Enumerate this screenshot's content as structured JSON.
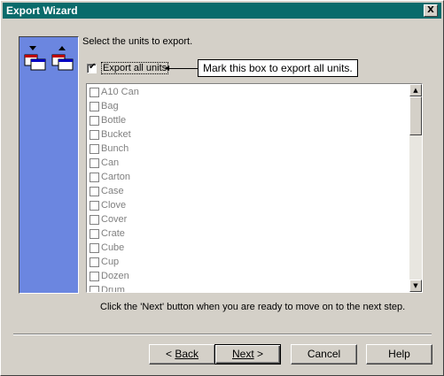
{
  "window": {
    "title": "Export Wizard",
    "close_glyph": "X"
  },
  "main": {
    "instruction": "Select the units to export.",
    "export_all": {
      "label": "Export all units",
      "checked": true
    },
    "callout": "Mark this box to export all units.",
    "units": [
      "A10 Can",
      "Bag",
      "Bottle",
      "Bucket",
      "Bunch",
      "Can",
      "Carton",
      "Case",
      "Clove",
      "Cover",
      "Crate",
      "Cube",
      "Cup",
      "Dozen",
      "Drum"
    ],
    "scroll_up_glyph": "▲",
    "scroll_down_glyph": "▼",
    "hint": "Click the 'Next' button when you are ready to move on to the next step."
  },
  "footer": {
    "back_arrow": "< ",
    "back_label": "Back",
    "next_label": "Next",
    "next_arrow": " >",
    "cancel_label": "Cancel",
    "help_label": "Help"
  },
  "colors": {
    "title_bar": "#0a6b6b",
    "side_panel": "#6b86e0",
    "face": "#d4d0c8"
  }
}
